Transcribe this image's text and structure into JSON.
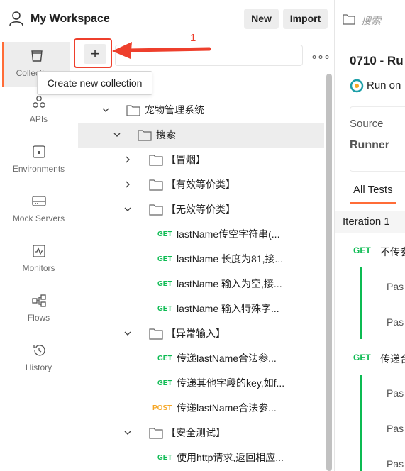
{
  "header": {
    "workspace_title": "My Workspace",
    "new_label": "New",
    "import_label": "Import"
  },
  "nav": {
    "items": [
      {
        "label": "Collections",
        "icon": "trash-can-icon"
      },
      {
        "label": "APIs",
        "icon": "apis-icon"
      },
      {
        "label": "Environments",
        "icon": "environments-icon"
      },
      {
        "label": "Mock Servers",
        "icon": "mock-server-icon"
      },
      {
        "label": "Monitors",
        "icon": "monitor-icon"
      },
      {
        "label": "Flows",
        "icon": "flows-icon"
      },
      {
        "label": "History",
        "icon": "history-icon"
      }
    ]
  },
  "toolbar": {
    "plus_label": "+",
    "more_label": "∘∘∘",
    "tooltip": "Create new collection",
    "annotation_number": "1"
  },
  "tree": {
    "collection": "宠物管理系统",
    "folder_search": "搜索",
    "folder_smoke": "【冒烟】",
    "folder_valid": "【有效等价类】",
    "folder_invalid": "【无效等价类】",
    "invalid_requests": [
      {
        "method": "GET",
        "name": "lastName传空字符串(..."
      },
      {
        "method": "GET",
        "name": "lastName 长度为81,接..."
      },
      {
        "method": "GET",
        "name": "lastName 输入为空,接..."
      },
      {
        "method": "GET",
        "name": "lastName 输入特殊字..."
      }
    ],
    "folder_abnormal": "【异常输入】",
    "abnormal_requests": [
      {
        "method": "GET",
        "name": "传递lastName合法参..."
      },
      {
        "method": "GET",
        "name": "传递其他字段的key,如f..."
      },
      {
        "method": "POST",
        "name": "传递lastName合法参..."
      }
    ],
    "folder_security": "【安全测试】",
    "security_requests": [
      {
        "method": "GET",
        "name": "使用http请求,返回相应..."
      }
    ]
  },
  "right": {
    "search_placeholder": "搜索",
    "title": "0710 - Ru",
    "run_on": "Run on",
    "source_label": "Source",
    "source_value": "Runner",
    "tab_all_tests": "All Tests",
    "iteration": "Iteration 1",
    "req1_method": "GET",
    "req1_name": "不传参",
    "req2_method": "GET",
    "req2_name": "传递合",
    "pass_label": "Pas"
  },
  "colors": {
    "accent": "#ff6c37",
    "get": "#0cbb52",
    "post": "#f6a623",
    "annotation": "#ee3f2c"
  }
}
